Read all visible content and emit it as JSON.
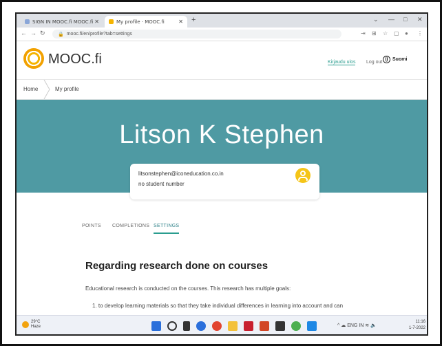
{
  "browser": {
    "tabs": [
      {
        "title": "SIGN IN MOOC.fi MOOC.fi",
        "favicon_color": "#8aa6d8"
      },
      {
        "title": "My profile · MOOC.fi",
        "favicon_color": "#f5b400"
      }
    ],
    "new_tab_label": "+",
    "url": "mooc.fi/en/profile?tab=settings",
    "window_controls": [
      "⌄",
      "—",
      "□",
      "✕"
    ]
  },
  "site": {
    "brand": "MOOC.fi",
    "login_label": "Kirjaudu ulos",
    "logout_label": "Log out",
    "language_label": "Suomi"
  },
  "breadcrumb": {
    "home": "Home",
    "current": "My profile"
  },
  "profile": {
    "name": "Litson K Stephen",
    "email": "litsonstephen@iconeducation.co.in",
    "student_number": "no student number"
  },
  "profile_tabs": [
    {
      "label": "POINTS",
      "active": false
    },
    {
      "label": "COMPLETIONS",
      "active": false
    },
    {
      "label": "SETTINGS",
      "active": true
    }
  ],
  "content": {
    "title": "Regarding research done on courses",
    "paragraph": "Educational research is conducted on the courses. This research has multiple goals:",
    "list_item_1": "1. to develop learning materials so that they take individual differences in learning into account and can"
  },
  "taskbar": {
    "weather_temp": "29°C",
    "weather_desc": "Haze",
    "tray_lang": "ENG IN",
    "time": "11:16",
    "date": "1-7-2022"
  },
  "colors": {
    "hero": "#4f9aa3",
    "accent": "#2a9d8f",
    "avatar": "#f5c518"
  }
}
